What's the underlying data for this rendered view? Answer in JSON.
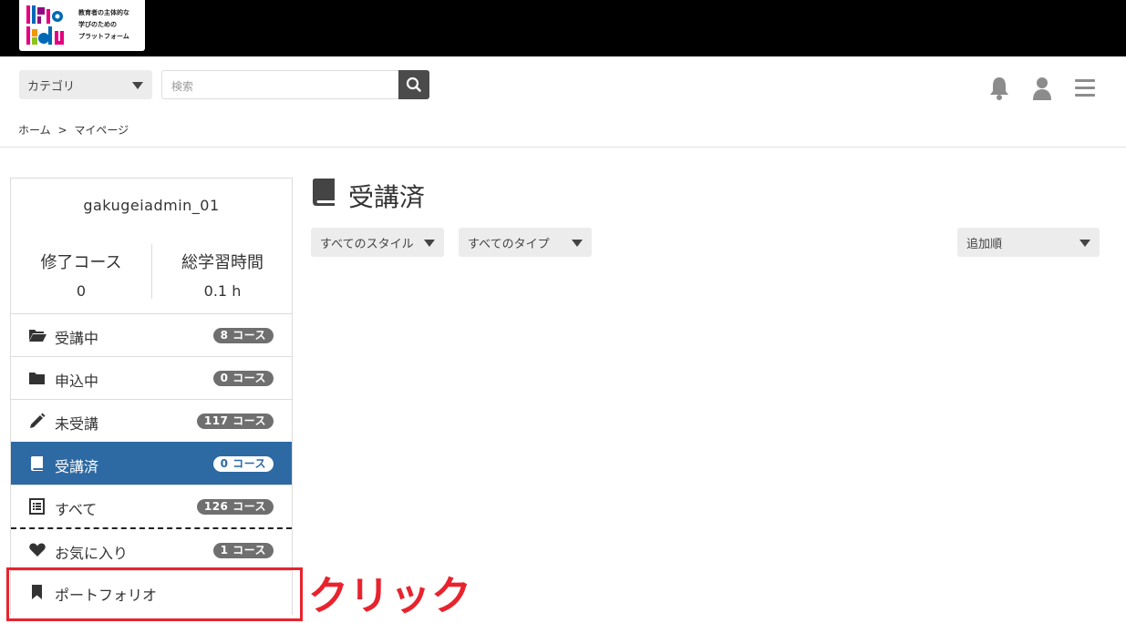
{
  "logo": {
    "tagline": "教育者の主体的な\n学びのための\nプラットフォーム",
    "colors": [
      "#e4007f",
      "#0068b7",
      "#f39800",
      "#8fc31f",
      "#920783"
    ]
  },
  "header": {
    "category_label": "カテゴリ",
    "search_placeholder": "検索",
    "icons": [
      "bell-icon",
      "user-icon",
      "hamburger-menu-icon"
    ]
  },
  "breadcrumb": {
    "home": "ホーム",
    "separator": ">",
    "current": "マイページ"
  },
  "sidebar": {
    "username": "gakugeiadmin_01",
    "stats": [
      {
        "label": "修了コース",
        "value": "0"
      },
      {
        "label": "総学習時間",
        "value": "0.1 h"
      }
    ],
    "items": [
      {
        "icon": "folder-open-icon",
        "label": "受講中",
        "badge": "8 コース"
      },
      {
        "icon": "folder-icon",
        "label": "申込中",
        "badge": "0 コース"
      },
      {
        "icon": "pencil-icon",
        "label": "未受講",
        "badge": "117 コース"
      },
      {
        "icon": "book-icon",
        "label": "受講済",
        "badge": "0 コース",
        "active": true
      },
      {
        "icon": "list-icon",
        "label": "すべて",
        "badge": "126 コース"
      },
      {
        "icon": "heart-icon",
        "label": "お気に入り",
        "badge": "1 コース"
      },
      {
        "icon": "bookmark-icon",
        "label": "ポートフォリオ"
      }
    ],
    "active_color": "#2d69a3"
  },
  "annotation": {
    "label": "クリック",
    "color": "#e8232d"
  },
  "main": {
    "title": "受講済",
    "filters": {
      "style": "すべてのスタイル",
      "type": "すべてのタイプ",
      "sort": "追加順"
    }
  }
}
